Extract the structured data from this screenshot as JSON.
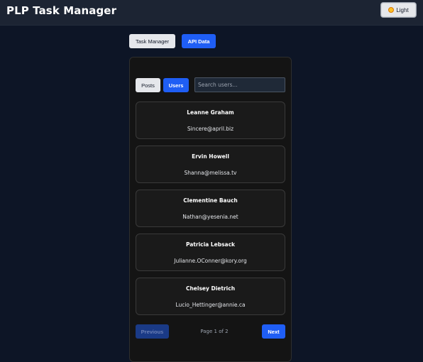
{
  "header": {
    "title": "PLP Task Manager",
    "theme_toggle_label": "Light"
  },
  "nav": {
    "task_manager_label": "Task Manager",
    "api_data_label": "API Data"
  },
  "api_panel": {
    "tabs": {
      "posts_label": "Posts",
      "users_label": "Users",
      "active": "Users"
    },
    "search": {
      "placeholder": "Search users...",
      "value": ""
    },
    "users": [
      {
        "name": "Leanne Graham",
        "email": "Sincere@april.biz"
      },
      {
        "name": "Ervin Howell",
        "email": "Shanna@melissa.tv"
      },
      {
        "name": "Clementine Bauch",
        "email": "Nathan@yesenia.net"
      },
      {
        "name": "Patricia Lebsack",
        "email": "Julianne.OConner@kory.org"
      },
      {
        "name": "Chelsey Dietrich",
        "email": "Lucio_Hettinger@annie.ca"
      }
    ],
    "pagination": {
      "previous_label": "Previous",
      "next_label": "Next",
      "page_info": "Page 1 of 2"
    }
  },
  "colors": {
    "background": "#0d1526",
    "header": "#1c2433",
    "accent": "#1f5ef5",
    "panel": "#141414"
  },
  "icons": {
    "theme_toggle": "sun-icon"
  }
}
